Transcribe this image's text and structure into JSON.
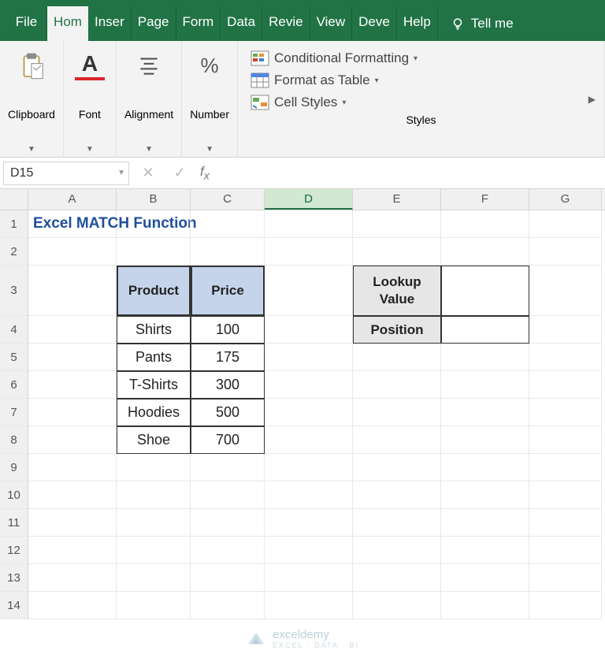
{
  "tabs": [
    "File",
    "Home",
    "Insert",
    "Page",
    "Form",
    "Data",
    "Revie",
    "View",
    "Deve",
    "Help"
  ],
  "tabs_display": [
    "File",
    "Hom",
    "Inser",
    "Page",
    "Form",
    "Data",
    "Revie",
    "View",
    "Deve",
    "Help"
  ],
  "active_tab": "Home",
  "tell_me": "Tell me",
  "ribbon": {
    "clipboard": "Clipboard",
    "font": "Font",
    "alignment": "Alignment",
    "number": "Number",
    "styles_label": "Styles",
    "cond_fmt": "Conditional Formatting",
    "fmt_table": "Format as Table",
    "cell_styles": "Cell Styles"
  },
  "namebox": "D15",
  "formula": "",
  "columns": [
    "A",
    "B",
    "C",
    "D",
    "E",
    "F",
    "G"
  ],
  "selected_col": "D",
  "title_cell": "Excel MATCH Function",
  "table": {
    "headers": [
      "Product",
      "Price"
    ],
    "rows": [
      [
        "Shirts",
        "100"
      ],
      [
        "Pants",
        "175"
      ],
      [
        "T-Shirts",
        "300"
      ],
      [
        "Hoodies",
        "500"
      ],
      [
        "Shoe",
        "700"
      ]
    ]
  },
  "lookup": {
    "label1": "Lookup Value",
    "label2": "Position",
    "val1": "",
    "val2": ""
  },
  "row_heights": {
    "1": 35,
    "2": 35,
    "3": 64,
    "def": 35
  },
  "visible_rows": 14,
  "watermark": {
    "brand": "exceldemy",
    "sub": "EXCEL · DATA · BI"
  }
}
